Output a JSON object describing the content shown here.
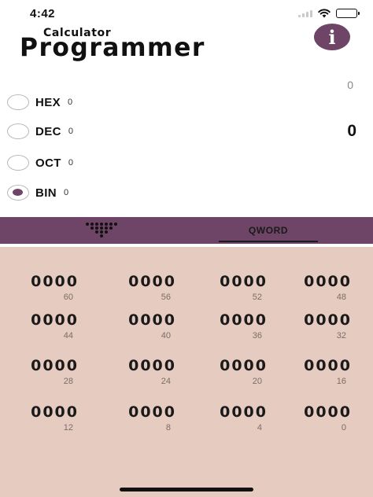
{
  "status": {
    "time": "4:42"
  },
  "header": {
    "subtitle": "Calculator",
    "title": "Programmer",
    "info_label": "i"
  },
  "display": {
    "top_value": "0",
    "main_value": "0"
  },
  "bases": [
    {
      "label": "HEX",
      "value": "0",
      "checked": false
    },
    {
      "label": "DEC",
      "value": "0",
      "checked": false
    },
    {
      "label": "OCT",
      "value": "0",
      "checked": false
    },
    {
      "label": "BIN",
      "value": "0",
      "checked": true
    }
  ],
  "tabs": {
    "bits_icon": "bit-grid-icon",
    "word_size": "QWORD"
  },
  "bit_groups": [
    {
      "digits": "0000",
      "index": "60"
    },
    {
      "digits": "0000",
      "index": "56"
    },
    {
      "digits": "0000",
      "index": "52"
    },
    {
      "digits": "0000",
      "index": "48"
    },
    {
      "digits": "0000",
      "index": "44"
    },
    {
      "digits": "0000",
      "index": "40"
    },
    {
      "digits": "0000",
      "index": "36"
    },
    {
      "digits": "0000",
      "index": "32"
    },
    {
      "digits": "0000",
      "index": "28"
    },
    {
      "digits": "0000",
      "index": "24"
    },
    {
      "digits": "0000",
      "index": "20"
    },
    {
      "digits": "0000",
      "index": "16"
    },
    {
      "digits": "0000",
      "index": "12"
    },
    {
      "digits": "0000",
      "index": "8"
    },
    {
      "digits": "0000",
      "index": "4"
    },
    {
      "digits": "0000",
      "index": "0"
    }
  ],
  "colors": {
    "accent": "#6e4566",
    "panel": "#e6cbc0"
  }
}
